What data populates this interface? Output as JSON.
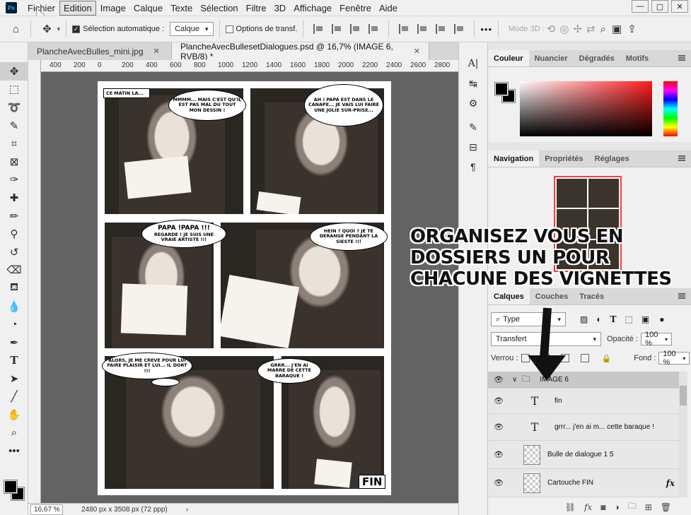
{
  "menu": {
    "items": [
      "Fichier",
      "Edition",
      "Image",
      "Calque",
      "Texte",
      "Sélection",
      "Filtre",
      "3D",
      "Affichage",
      "Fenêtre",
      "Aide"
    ],
    "active_index": 1
  },
  "options_bar": {
    "auto_select_label": "Sélection automatique :",
    "auto_select_value": "Calque",
    "transform_label": "Options de transf.",
    "mode3d_label": "Mode 3D :",
    "more_label": "•••"
  },
  "tabs": [
    {
      "label": "PlancheAvecBulles_mini.jpg"
    },
    {
      "label": "PlancheAvecBullesetDialogues.psd @ 16,7% (IMAGE 6, RVB/8) *"
    }
  ],
  "ruler_ticks": [
    "400",
    "200",
    "0",
    "200",
    "400",
    "600",
    "800",
    "1000",
    "1200",
    "1400",
    "1600",
    "1800",
    "2000",
    "2200",
    "2400",
    "2600",
    "2800"
  ],
  "comic": {
    "caption1": "CE MATIN LA...",
    "bubble1": "MMMM... MAIS C'EST QU'IL EST PAS MAL DU TOUT MON DESSIN !",
    "bubble2": "AH ! PAPA EST DANS LE CANAPE... JE VAIS LUI FAIRE UNE JOLIE SUR-PRISE...",
    "bubble3_title": "PAPA !PAPA !!!",
    "bubble3": "REGARDE ! JE SUIS UNE VRAIE ARTISTE !!!",
    "bubble4": "HEIN ? QUOI ? JE TE DERANGE PENDANT LA SIESTE !!!",
    "bubble5": "ALORS, JE ME CREVE POUR LUI FAIRE PLAISIR ET LUI... IL DORT !!!",
    "bubble6": "GRRR... J'EN AI MARRE DE CETTE BARAQUE !",
    "fin": "FIN"
  },
  "status": {
    "zoom": "16,67 %",
    "doc_info": "2480 px x 3508 px (72 ppp)"
  },
  "color_panel": {
    "tabs": [
      "Couleur",
      "Nuancier",
      "Dégradés",
      "Motifs"
    ],
    "active_index": 0
  },
  "nav_panel": {
    "tabs": [
      "Navigation",
      "Propriétés",
      "Réglages"
    ],
    "active_index": 0
  },
  "layers_panel": {
    "tabs": [
      "Calques",
      "Couches",
      "Tracés"
    ],
    "filter_value": "Type",
    "blend_mode": "Transfert",
    "opacity_label": "Opacité :",
    "opacity_value": "100 %",
    "lock_label": "Verrou :",
    "fill_label": "Fond :",
    "fill_value": "100 %",
    "layers": [
      {
        "name": "IMAGE 6",
        "kind": "group"
      },
      {
        "name": "fin",
        "kind": "text"
      },
      {
        "name": "grrr... j'en ai m... cette baraque !",
        "kind": "text"
      },
      {
        "name": "Bulle de dialogue 1 5",
        "kind": "pixel"
      },
      {
        "name": "Cartouche FIN",
        "kind": "pixel",
        "fx": "fx"
      }
    ]
  },
  "annotation": {
    "line1": "ORGANISEZ VOUS EN",
    "line2": "DOSSIERS UN POUR",
    "line3": "CHACUNE DES VIGNETTES"
  }
}
